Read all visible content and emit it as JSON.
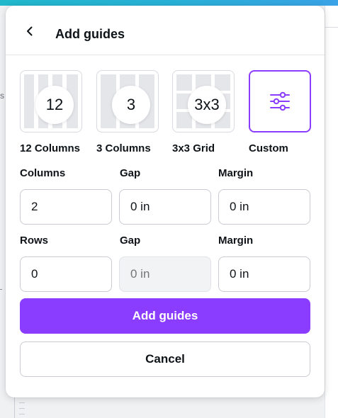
{
  "header": {
    "title": "Add guides",
    "back_icon": "chevron-left-icon"
  },
  "presets": [
    {
      "id": "12-columns",
      "badge": "12",
      "label": "12 Columns",
      "selected": false
    },
    {
      "id": "3-columns",
      "badge": "3",
      "label": "3 Columns",
      "selected": false
    },
    {
      "id": "3x3-grid",
      "badge": "3x3",
      "label": "3x3 Grid",
      "selected": false
    },
    {
      "id": "custom",
      "icon": "sliders-icon",
      "label": "Custom",
      "selected": true
    }
  ],
  "columns_row": {
    "count_label": "Columns",
    "count_value": "2",
    "gap_label": "Gap",
    "gap_value": "0 in",
    "margin_label": "Margin",
    "margin_value": "0 in"
  },
  "rows_row": {
    "count_label": "Rows",
    "count_value": "0",
    "gap_label": "Gap",
    "gap_placeholder": "0 in",
    "margin_label": "Margin",
    "margin_value": "0 in"
  },
  "actions": {
    "add_label": "Add guides",
    "cancel_label": "Cancel"
  },
  "colors": {
    "accent": "#8b3dff",
    "border": "#c9ccd2",
    "text": "#0e1318",
    "disabled_bg": "#f2f3f5"
  }
}
